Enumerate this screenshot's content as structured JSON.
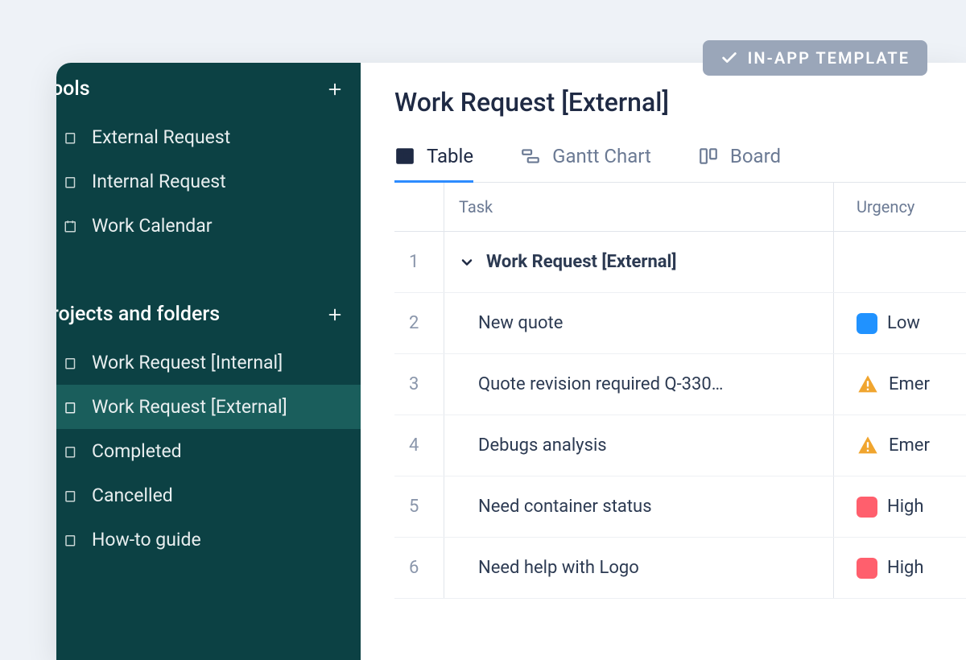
{
  "badge": {
    "label": "IN-APP TEMPLATE"
  },
  "sidebar": {
    "sections": [
      {
        "title": "ools",
        "items": [
          {
            "label": "External Request",
            "icon": "folder",
            "selected": false
          },
          {
            "label": "Internal Request",
            "icon": "folder",
            "selected": false
          },
          {
            "label": "Work Calendar",
            "icon": "calendar",
            "selected": false
          }
        ]
      },
      {
        "title": "rojects and folders",
        "items": [
          {
            "label": "Work Request [Internal]",
            "icon": "folder",
            "selected": false
          },
          {
            "label": "Work Request [External]",
            "icon": "folder",
            "selected": true
          },
          {
            "label": "Completed",
            "icon": "folder",
            "selected": false
          },
          {
            "label": "Cancelled",
            "icon": "folder",
            "selected": false
          },
          {
            "label": "How-to guide",
            "icon": "folder",
            "selected": false
          }
        ]
      }
    ]
  },
  "main": {
    "title": "Work Request [External]",
    "tabs": [
      {
        "label": "Table",
        "icon": "table",
        "active": true
      },
      {
        "label": "Gantt Chart",
        "icon": "gantt",
        "active": false
      },
      {
        "label": "Board",
        "icon": "board",
        "active": false
      }
    ],
    "columns": {
      "task": "Task",
      "urgency": "Urgency"
    },
    "rows": [
      {
        "num": "1",
        "task": "Work Request [External]",
        "group": true,
        "urgency": null
      },
      {
        "num": "2",
        "task": "New quote",
        "urgency": {
          "type": "swatch",
          "color": "low",
          "label": "Low"
        }
      },
      {
        "num": "3",
        "task": "Quote revision required Q-330…",
        "urgency": {
          "type": "warn",
          "label": "Emer"
        }
      },
      {
        "num": "4",
        "task": "Debugs analysis",
        "urgency": {
          "type": "warn",
          "label": "Emer"
        }
      },
      {
        "num": "5",
        "task": "Need container status",
        "urgency": {
          "type": "swatch",
          "color": "high",
          "label": "High"
        }
      },
      {
        "num": "6",
        "task": "Need help with Logo",
        "urgency": {
          "type": "swatch",
          "color": "high",
          "label": "High"
        }
      }
    ]
  }
}
